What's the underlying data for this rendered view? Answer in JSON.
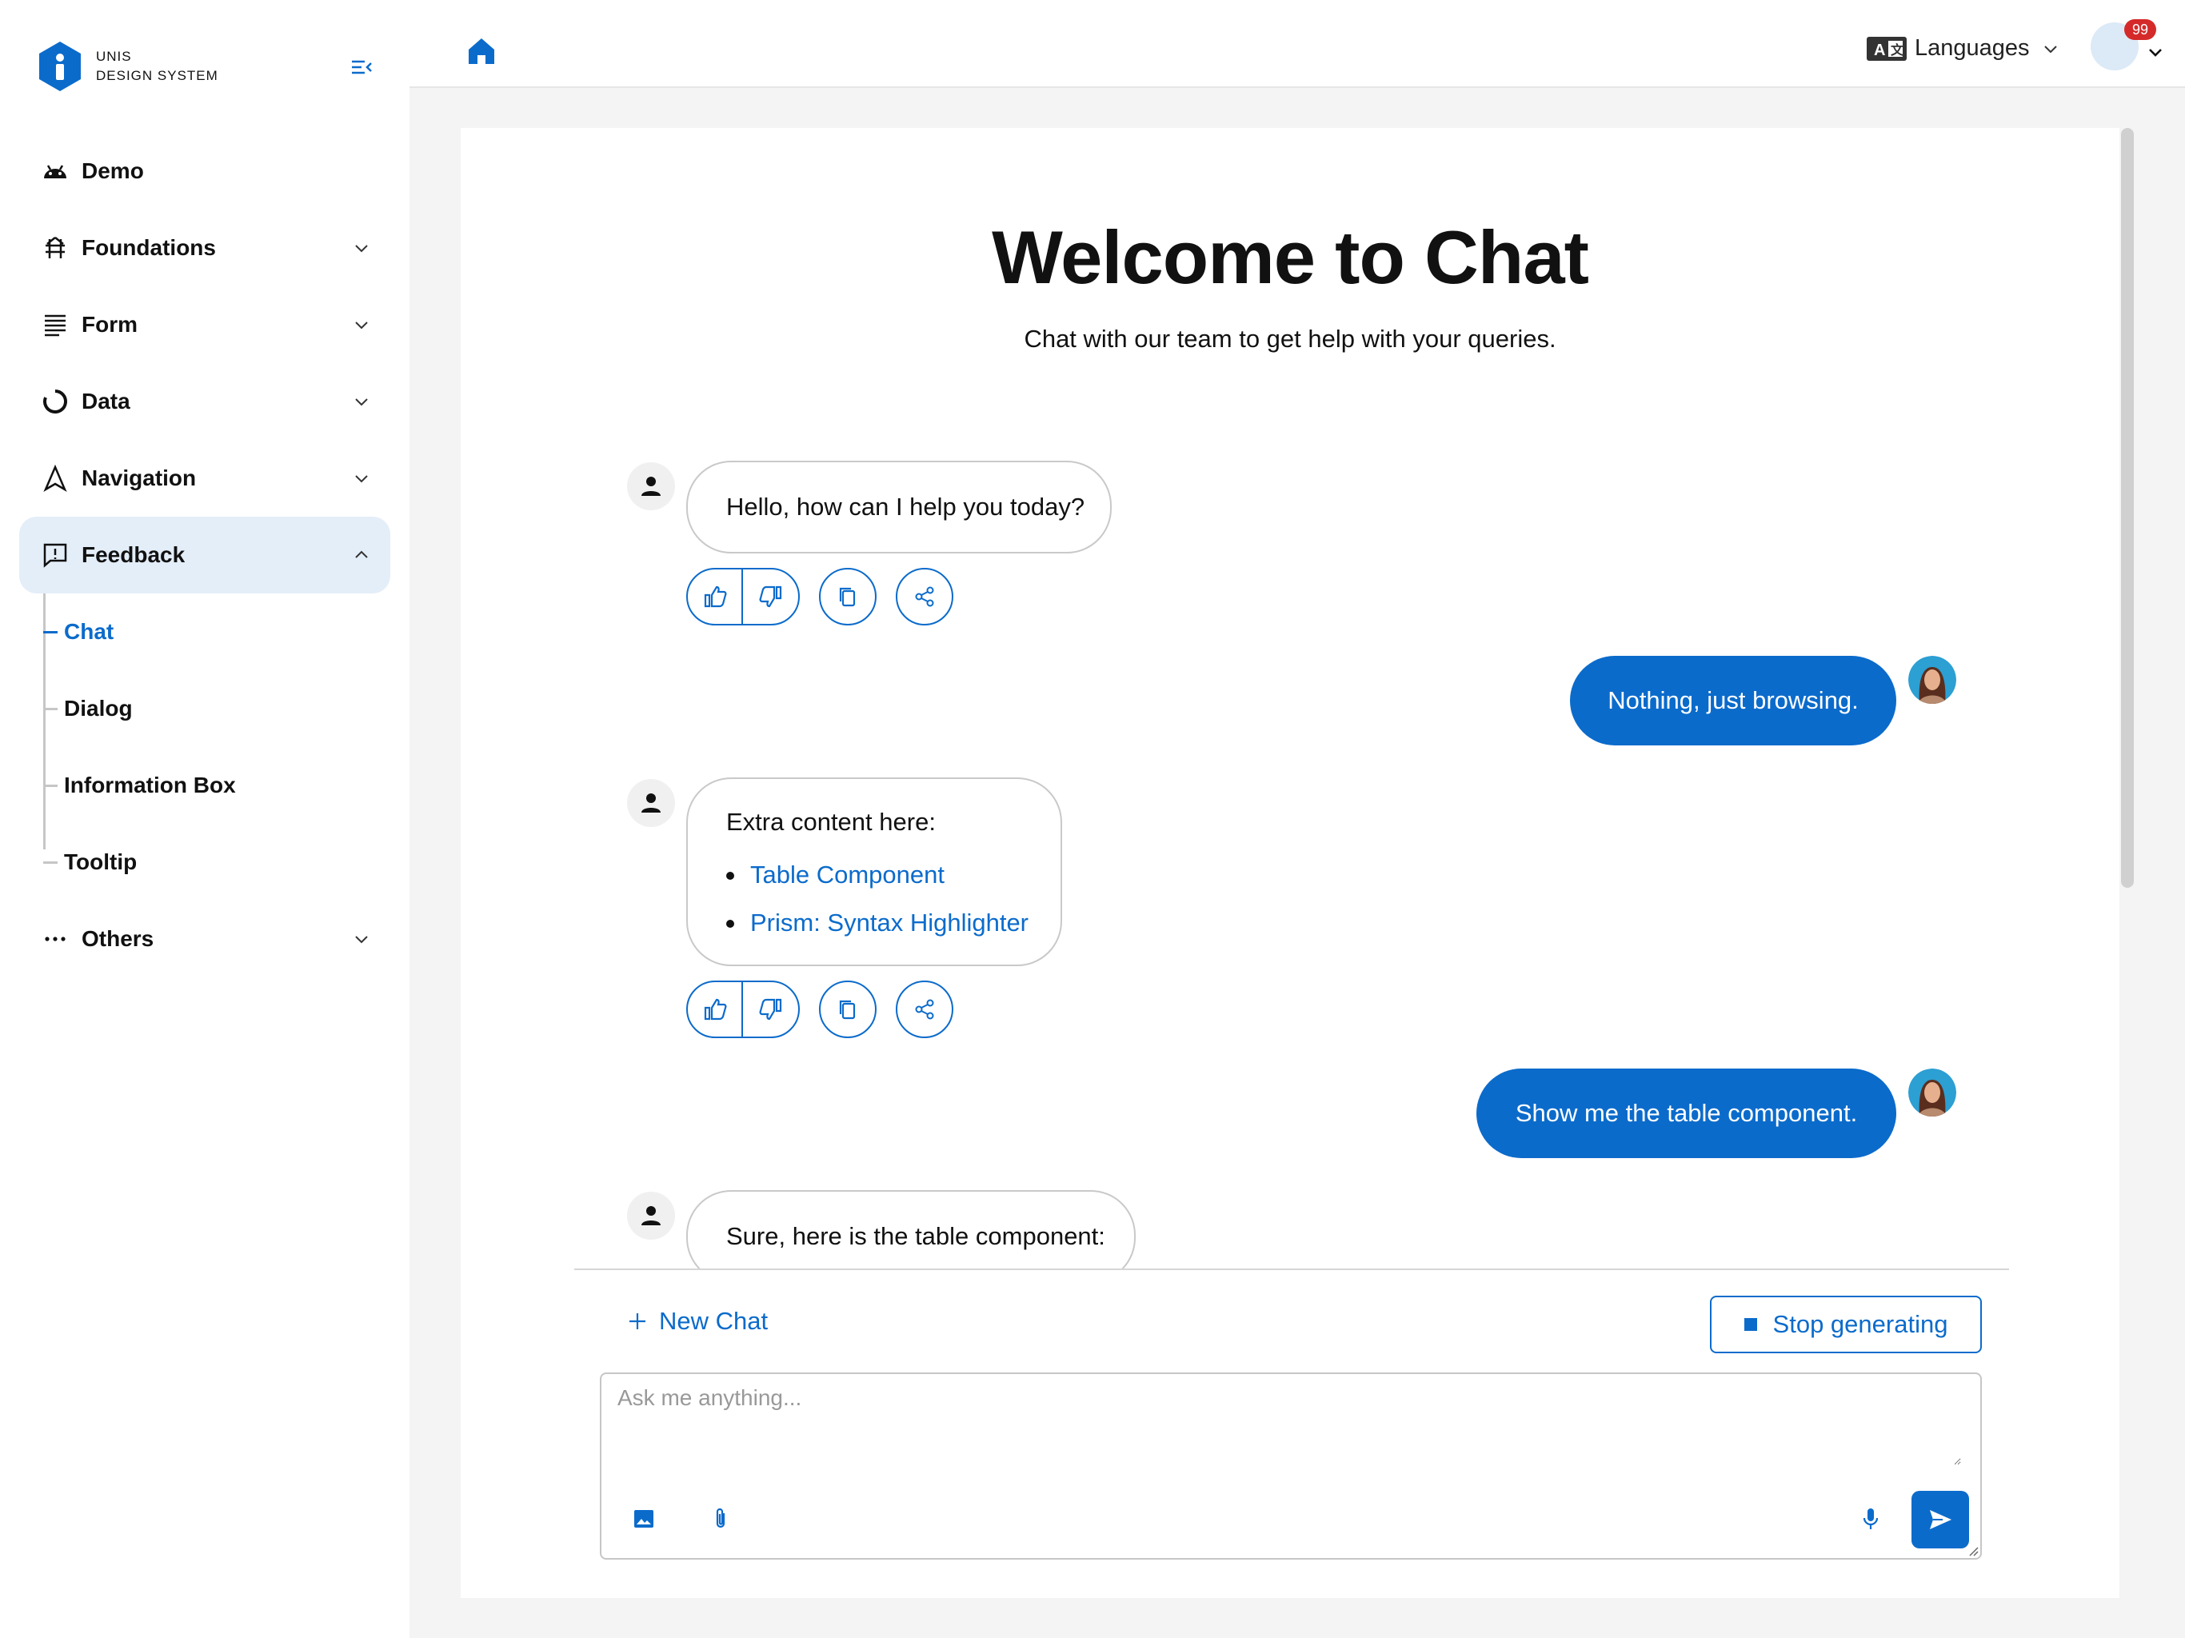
{
  "brand": {
    "line1": "UNIS",
    "line2": "DESIGN SYSTEM"
  },
  "sidebar": {
    "items": [
      {
        "label": "Demo",
        "icon": "android-icon"
      },
      {
        "label": "Foundations",
        "icon": "structure-icon"
      },
      {
        "label": "Form",
        "icon": "text-align-icon"
      },
      {
        "label": "Data",
        "icon": "donut-icon"
      },
      {
        "label": "Navigation",
        "icon": "navigation-icon"
      },
      {
        "label": "Feedback",
        "icon": "feedback-icon"
      },
      {
        "label": "Others",
        "icon": "more-icon"
      }
    ],
    "feedback_children": [
      "Chat",
      "Dialog",
      "Information Box",
      "Tooltip"
    ],
    "active_child": "Chat"
  },
  "topbar": {
    "languages_label": "Languages",
    "notification_count": "99"
  },
  "chat": {
    "title": "Welcome to Chat",
    "subtitle": "Chat with our team to get help with your queries.",
    "messages": {
      "m1": "Hello, how can I help you today?",
      "m2": "Nothing, just browsing.",
      "m3_intro": "Extra content here:",
      "m3_link1": "Table Component",
      "m3_link2": "Prism: Syntax Highlighter",
      "m4": "Show me the table component.",
      "m5": "Sure, here is the table component:"
    },
    "new_chat_label": "New Chat",
    "stop_label": "Stop generating",
    "input_placeholder": "Ask me anything..."
  },
  "colors": {
    "accent": "#0b6bcb",
    "badge": "#d52a2a",
    "active_bg": "#e4eef9"
  }
}
